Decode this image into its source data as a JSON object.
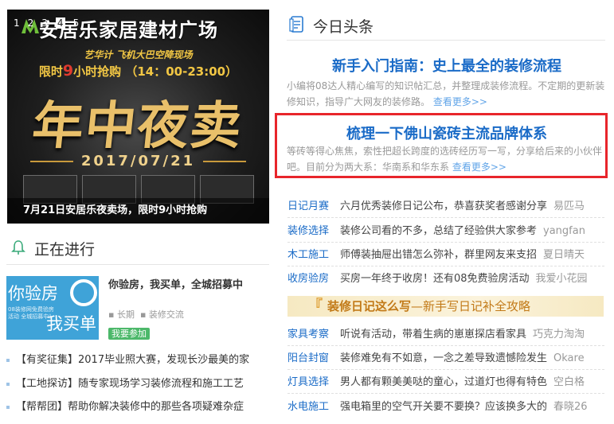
{
  "banner": {
    "brand": "安居乐家居建材广场",
    "slide_numbers": [
      "1",
      "2",
      "3",
      "4",
      "5"
    ],
    "line1": "艺华计 飞机大巴空降现场",
    "line2_a": "限时",
    "line2_b": "9",
    "line2_c": "小时抢购",
    "line2_d": "（14：00-23:00）",
    "headline": "年中夜卖",
    "date": "2017/07/21",
    "caption": "7月21日安居乐夜卖场，限时9小时抢购"
  },
  "headlines": {
    "section_title": "今日头条",
    "section_icon": "news-icon",
    "items": [
      {
        "title": "新手入门指南：史上最全的装修流程",
        "desc": "小编将08达人精心编写的知识帖汇总，并整理成装修流程。不定期的更新装修知识，指导广大网友的装修路。",
        "more": "查看更多>>"
      },
      {
        "title": "梳理一下佛山瓷砖主流品牌体系",
        "desc": "等砖等得心焦焦，索性把超长跨度的选砖经历写一写，分享给后来的小伙伴吧。目前分为两大系：华南系和华东系",
        "more": "查看更多>>"
      }
    ]
  },
  "diary_list": [
    {
      "cat": "日记月赛",
      "text": "六月优秀装修日记公布，恭喜获奖者感谢分享",
      "author": "易匹马"
    },
    {
      "cat": "装修选择",
      "text": "装修公司看的不多，总结了经验供大家参考",
      "author": "yangfan"
    },
    {
      "cat": "木工施工",
      "text": "师傅装抽屉出错怎么弥补，群里网友来支招",
      "author": "夏日晴天"
    },
    {
      "cat": "收房验房",
      "text": "买房一年终于收房！还有08免费验房活动",
      "author": "我爱小花园"
    }
  ],
  "promo": {
    "bold": "装修日记这么写",
    "rest": "—新手写日记补全攻略"
  },
  "diary_list2": [
    {
      "cat": "家具考察",
      "text": "听说有活动，带着生病的崽崽探店看家具",
      "author": "巧克力淘淘"
    },
    {
      "cat": "阳台封窗",
      "text": "装修难免有不如意，一念之差导致遗憾险发生",
      "author": "Okare"
    },
    {
      "cat": "灯具选择",
      "text": "男人都有颗美美哒的童心，过道灯也得有特色",
      "author": "空白格"
    },
    {
      "cat": "水电施工",
      "text": "强电箱里的空气开关要不要换？应该换多大的",
      "author": "春晓26"
    }
  ],
  "ongoing": {
    "section_title": "正在进行",
    "section_icon": "bell-icon",
    "thumb": {
      "t1": "你验房",
      "t2": "我买单",
      "small": "08装修网免费验房活动 全城招募中！"
    },
    "title": "你验房，我买单，全城招募中",
    "meta1": "长期",
    "meta2": "装修交流",
    "join": "我要参加",
    "bullets": [
      "【有奖征集】2017毕业照大赛，发现长沙最美的家",
      "【工地探访】随专家现场学习装修流程和施工工艺",
      "【帮帮团】帮助你解决装修中的那些各项疑难杂症"
    ]
  },
  "colors": {
    "accent_blue": "#1a6bc7",
    "highlight_red": "#e8252b",
    "muted": "#999999"
  }
}
